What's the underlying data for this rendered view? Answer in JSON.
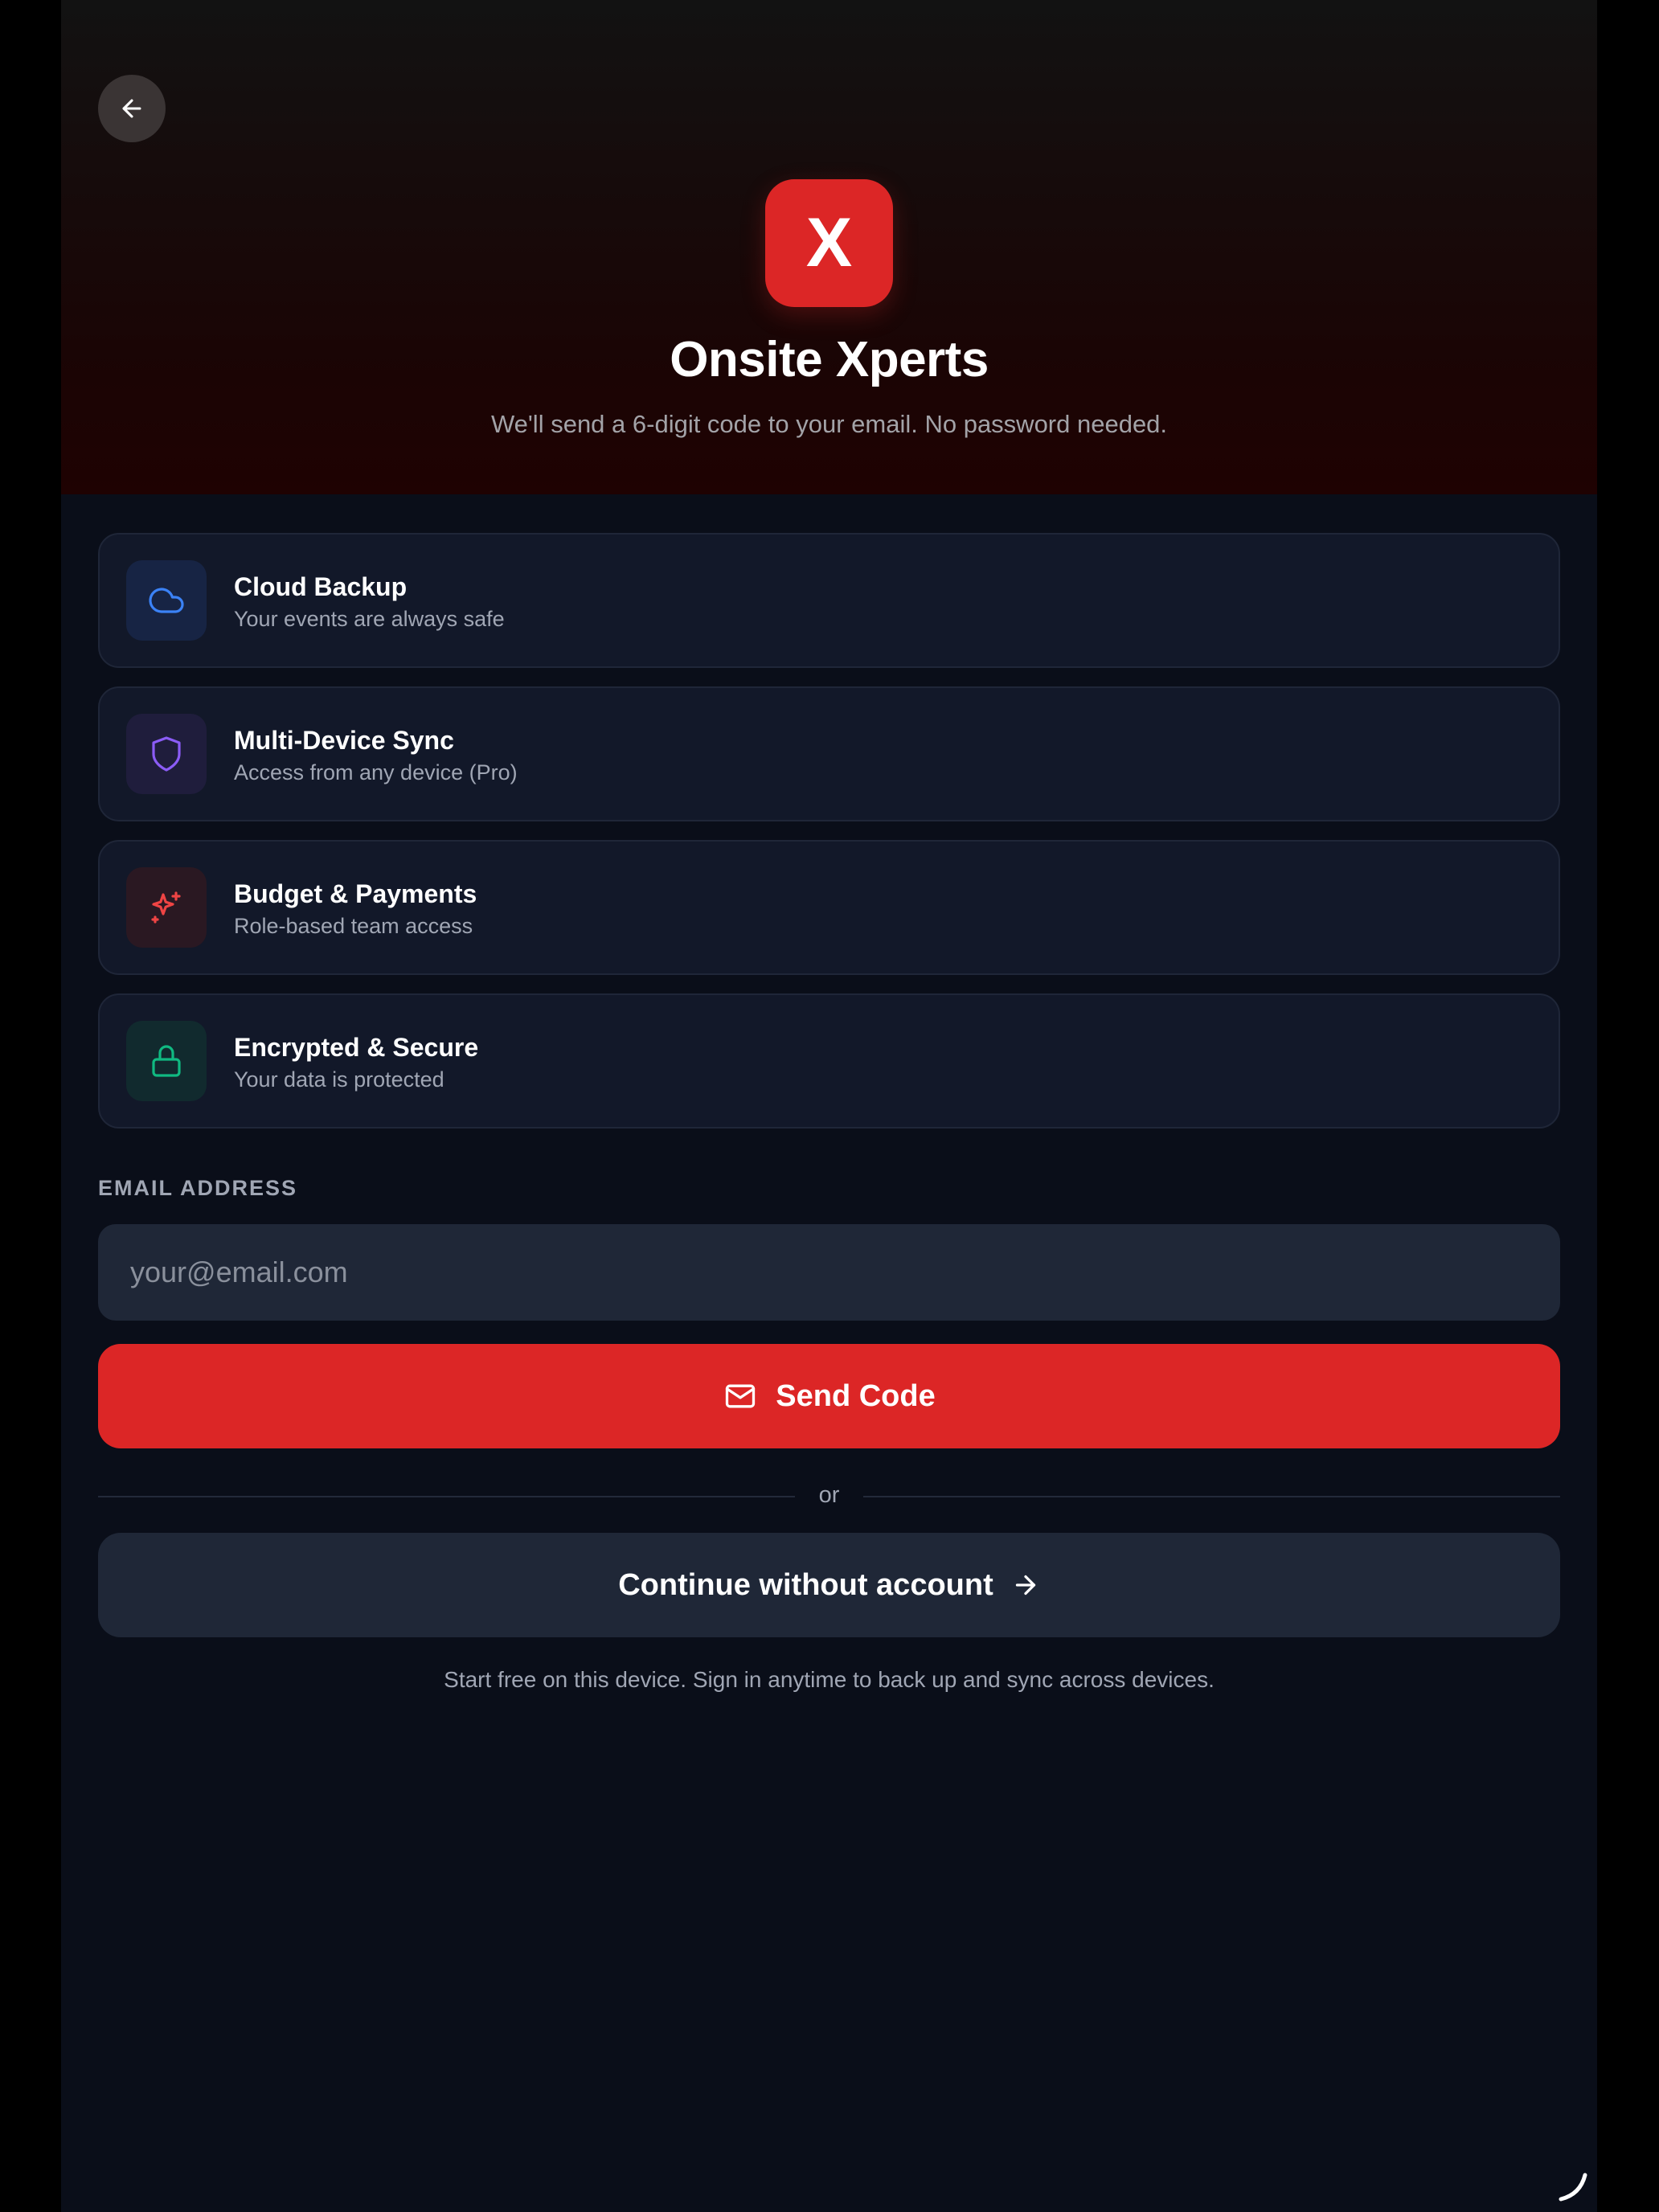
{
  "header": {
    "back_icon": "arrow-left-icon",
    "logo_letter": "X",
    "title": "Onsite Xperts",
    "subtitle": "We'll send a 6-digit code to your email. No password needed."
  },
  "features": [
    {
      "icon": "cloud-icon",
      "title": "Cloud Backup",
      "description": "Your events are always safe",
      "accent": "#3b82f6",
      "bg": "#172444"
    },
    {
      "icon": "shield-icon",
      "title": "Multi-Device Sync",
      "description": "Access from any device (Pro)",
      "accent": "#8b5cf6",
      "bg": "#1f1d3c"
    },
    {
      "icon": "sparkles-icon",
      "title": "Budget & Payments",
      "description": "Role-based team access",
      "accent": "#ef4444",
      "bg": "#2a1822"
    },
    {
      "icon": "lock-icon",
      "title": "Encrypted & Secure",
      "description": "Your data is protected",
      "accent": "#10b981",
      "bg": "#112a2e"
    }
  ],
  "form": {
    "email_label": "EMAIL ADDRESS",
    "email_placeholder": "your@email.com",
    "email_value": "",
    "send_label": "Send Code",
    "send_icon": "mail-icon",
    "divider_text": "or",
    "guest_label": "Continue without account",
    "guest_icon": "arrow-right-icon",
    "footer_note": "Start free on this device. Sign in anytime to back up and sync across devices."
  },
  "colors": {
    "primary": "#dc2626",
    "background": "#0a0e19",
    "card": "#121829",
    "input": "#1f2737"
  }
}
